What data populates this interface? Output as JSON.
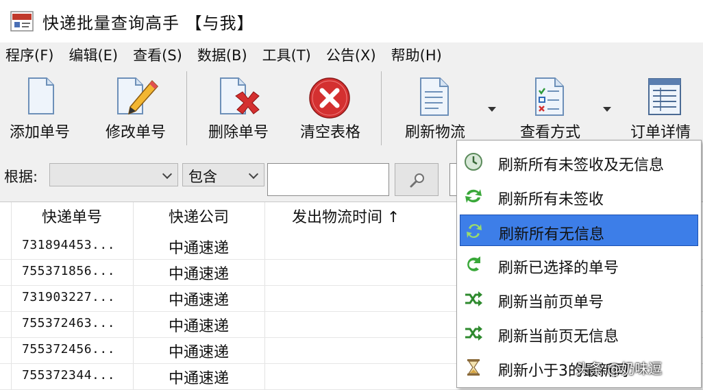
{
  "window": {
    "title": "快递批量查询高手 【与我】"
  },
  "menu": [
    {
      "label": "程序(F)"
    },
    {
      "label": "编辑(E)"
    },
    {
      "label": "查看(S)"
    },
    {
      "label": "数据(B)"
    },
    {
      "label": "工具(T)"
    },
    {
      "label": "公告(X)"
    },
    {
      "label": "帮助(H)"
    }
  ],
  "toolbar": {
    "add": "添加单号",
    "edit": "修改单号",
    "delete": "删除单号",
    "clear": "清空表格",
    "refresh": "刷新物流",
    "view": "查看方式",
    "detail": "订单详情"
  },
  "filter": {
    "label": "根据:",
    "field_value": "",
    "match_value": "包含",
    "search_value": ""
  },
  "table": {
    "headers": [
      "快递单号",
      "快递公司",
      "发出物流时间 ↑"
    ],
    "rows": [
      {
        "num": "731894453...",
        "company": "中通速递"
      },
      {
        "num": "755371856...",
        "company": "中通速递"
      },
      {
        "num": "731903227...",
        "company": "中通速递"
      },
      {
        "num": "755372463...",
        "company": "中通速递"
      },
      {
        "num": "755372456...",
        "company": "中通速递"
      },
      {
        "num": "755372344...",
        "company": "中通速递"
      }
    ]
  },
  "refresh_menu": {
    "items": [
      {
        "label": "刷新所有未签收及无信息"
      },
      {
        "label": "刷新所有未签收"
      },
      {
        "label": "刷新所有无信息"
      },
      {
        "label": "刷新已选择的单号"
      },
      {
        "label": "刷新当前页单号"
      },
      {
        "label": "刷新当前页无信息"
      },
      {
        "label": "刷新小于3的最新同"
      }
    ],
    "selected_index": 2
  },
  "watermark": "头条 @奶味逗",
  "colors": {
    "selection": "#3d7ee8",
    "toolbar_bg": "#f0f0f0",
    "delete_red": "#d43030"
  }
}
